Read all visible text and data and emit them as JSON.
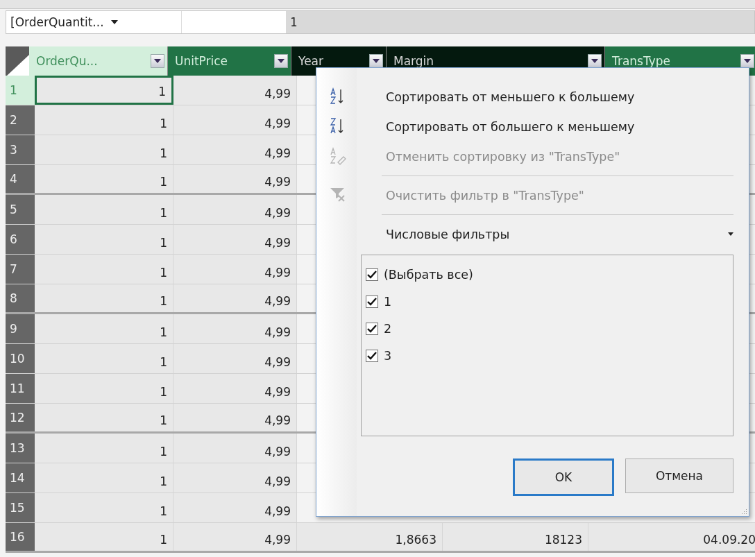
{
  "formula_bar": {
    "name_box": "[OrderQuantit...",
    "value": "1"
  },
  "columns": [
    {
      "label": "OrderQu...",
      "kind": "light"
    },
    {
      "label": "UnitPrice",
      "kind": "green"
    },
    {
      "label": "Year",
      "kind": "dark"
    },
    {
      "label": "Margin",
      "kind": "dark"
    },
    {
      "label": "TransType",
      "kind": "green"
    }
  ],
  "rows": [
    {
      "number": "1",
      "selected": true,
      "cells": [
        "1",
        "4,99"
      ]
    },
    {
      "number": "2",
      "selected": false,
      "cells": [
        "1",
        "4,99"
      ]
    },
    {
      "number": "3",
      "selected": false,
      "cells": [
        "1",
        "4,99"
      ]
    },
    {
      "number": "4",
      "selected": false,
      "cells": [
        "1",
        "4,99"
      ]
    },
    {
      "number": "5",
      "selected": false,
      "cells": [
        "1",
        "4,99"
      ]
    },
    {
      "number": "6",
      "selected": false,
      "cells": [
        "1",
        "4,99"
      ]
    },
    {
      "number": "7",
      "selected": false,
      "cells": [
        "1",
        "4,99"
      ]
    },
    {
      "number": "8",
      "selected": false,
      "cells": [
        "1",
        "4,99"
      ]
    },
    {
      "number": "9",
      "selected": false,
      "cells": [
        "1",
        "4,99"
      ]
    },
    {
      "number": "10",
      "selected": false,
      "cells": [
        "1",
        "4,99"
      ]
    },
    {
      "number": "11",
      "selected": false,
      "cells": [
        "1",
        "4,99"
      ]
    },
    {
      "number": "12",
      "selected": false,
      "cells": [
        "1",
        "4,99"
      ]
    },
    {
      "number": "13",
      "selected": false,
      "cells": [
        "1",
        "4,99"
      ]
    },
    {
      "number": "14",
      "selected": false,
      "cells": [
        "1",
        "4,99"
      ]
    },
    {
      "number": "15",
      "selected": false,
      "cells": [
        "1",
        "4,99"
      ]
    },
    {
      "number": "16",
      "selected": false,
      "cells": [
        "1",
        "4,99",
        "1,8663",
        "18123",
        "04.09.20"
      ]
    }
  ],
  "filter_menu": {
    "items": [
      {
        "kind": "sort_asc",
        "label": "Сортировать от меньшего к большему",
        "disabled": false
      },
      {
        "kind": "sort_desc",
        "label": "Сортировать от большего к меньшему",
        "disabled": false
      },
      {
        "kind": "clear_sort",
        "label": "Отменить сортировку из \"TransType\"",
        "disabled": true
      },
      {
        "kind": "clear_filter",
        "label": "Очистить фильтр в \"TransType\"",
        "disabled": true
      },
      {
        "kind": "submenu",
        "label": "Числовые фильтры",
        "disabled": false
      }
    ],
    "values": [
      {
        "label": "(Выбрать все)",
        "checked": true
      },
      {
        "label": "1",
        "checked": true
      },
      {
        "label": "2",
        "checked": true
      },
      {
        "label": "3",
        "checked": true
      }
    ],
    "buttons": [
      {
        "label": "OK",
        "default": true
      },
      {
        "label": "Отмена",
        "default": false
      }
    ]
  }
}
